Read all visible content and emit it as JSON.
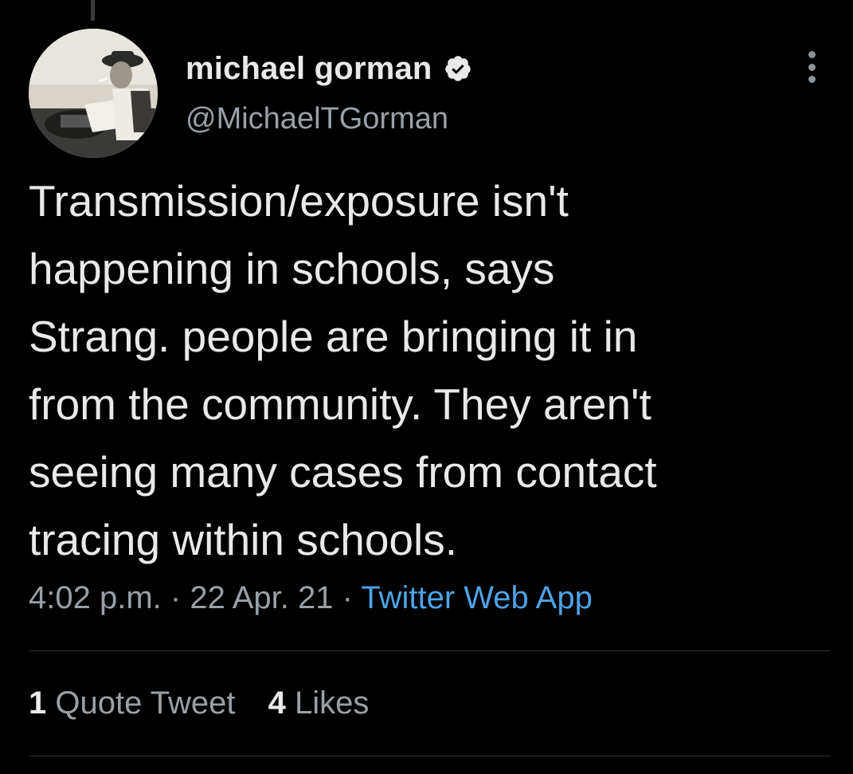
{
  "tweet": {
    "author": {
      "display_name": "michael gorman",
      "handle": "@MichaelTGorman",
      "verified": true,
      "avatar": "avatar-photo"
    },
    "text": "Transmission/exposure isn't\nhappening in schools, says\nStrang. people are bringing it in\nfrom the community. They aren't\nseeing many cases from contact\ntracing within schools.",
    "time": "4:02 p.m.",
    "separator": "·",
    "date": "22 Apr. 21",
    "source": "Twitter Web App",
    "stats": {
      "quote_count": "1",
      "quote_label": "Quote Tweet",
      "like_count": "4",
      "like_label": "Likes"
    }
  },
  "icons": {
    "verified": "verified-badge-icon",
    "more": "more-options-icon"
  },
  "colors": {
    "background": "#000000",
    "text": "#e7e9ea",
    "secondary": "#9aa0a6",
    "link": "#4da3e6",
    "divider": "#2f3336"
  }
}
